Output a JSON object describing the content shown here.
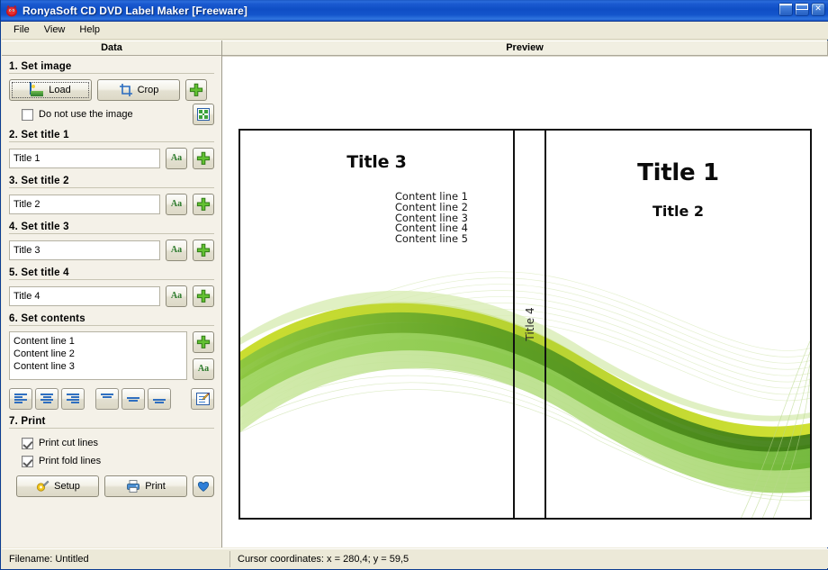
{
  "window": {
    "title": "RonyaSoft CD DVD Label Maker [Freeware]",
    "app_icon": "app-logo-icon",
    "minimize_label": "Minimize",
    "maximize_label": "Maximize",
    "close_label": "Close"
  },
  "menu": {
    "items": [
      {
        "label": "File"
      },
      {
        "label": "View"
      },
      {
        "label": "Help"
      }
    ]
  },
  "panels": {
    "data_header": "Data",
    "preview_header": "Preview"
  },
  "sections": {
    "image": {
      "title": "1. Set image",
      "load_label": "Load",
      "crop_label": "Crop",
      "position_icon": "green-move-icon",
      "scale_icon": "grid-resize-icon",
      "checkbox_label": "Do not use the image",
      "checkbox_checked": false
    },
    "title1": {
      "title": "2. Set title 1",
      "value": "Title 1",
      "font_icon": "font-aa-icon",
      "move_icon": "green-move-icon"
    },
    "title2": {
      "title": "3. Set title 2",
      "value": "Title 2",
      "font_icon": "font-aa-icon",
      "move_icon": "green-move-icon"
    },
    "title3": {
      "title": "4. Set title 3",
      "value": "Title 3",
      "font_icon": "font-aa-icon",
      "move_icon": "green-move-icon"
    },
    "title4": {
      "title": "5. Set title 4",
      "value": "Title 4",
      "font_icon": "font-aa-icon",
      "move_icon": "green-move-icon"
    },
    "contents": {
      "title": "6. Set contents",
      "value": "Content line 1\nContent line 2\nContent line 3",
      "move_icon": "green-move-icon",
      "font_icon": "font-aa-icon",
      "align_left_label": "Align left",
      "align_center_label": "Align center",
      "align_right_label": "Align right",
      "valign_top_label": "Align top",
      "valign_middle_label": "Align middle",
      "valign_bottom_label": "Align bottom",
      "edit_label": "Edit text"
    },
    "print": {
      "title": "7. Print",
      "cut_lines_label": "Print cut lines",
      "cut_lines_checked": true,
      "fold_lines_label": "Print fold lines",
      "fold_lines_checked": true,
      "setup_label": "Setup",
      "print_label": "Print",
      "favorite_icon": "blue-heart-icon"
    }
  },
  "preview": {
    "back_title": "Title 3",
    "content_lines": [
      "Content line 1",
      "Content line 2",
      "Content line 3",
      "Content line 4",
      "Content line 5"
    ],
    "spine_title": "Title 4",
    "front_title": "Title 1",
    "front_subtitle": "Title 2"
  },
  "statusbar": {
    "filename": "Filename: Untitled",
    "cursor": "Cursor coordinates: x = 280,4; y =  59,5"
  },
  "colors": {
    "titlebar_blue": "#1a58c4",
    "panel_bg": "#f4f1e8",
    "chrome_bg": "#ece9d8",
    "swirl_dark_green": "#4e8c1e",
    "swirl_mid_green": "#7ec242",
    "swirl_yellow_green": "#c6d92b",
    "swirl_light_green": "#a9d96a",
    "accent_blue": "#2f6fc0"
  }
}
